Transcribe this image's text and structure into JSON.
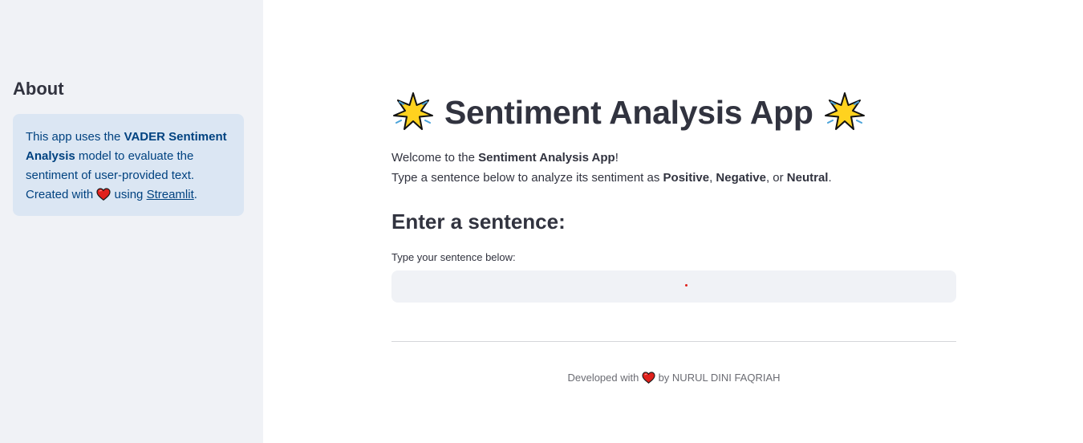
{
  "sidebar": {
    "title": "About",
    "info": {
      "t1": "This app uses the ",
      "b1": "VADER Sentiment Analysis",
      "t2": " model to evaluate the sentiment of user-provided text. Created with ",
      "t3": " using ",
      "link": "Streamlit",
      "t4": "."
    }
  },
  "main": {
    "title": "Sentiment Analysis App",
    "intro": {
      "l1a": "Welcome to the ",
      "l1b": "Sentiment Analysis App",
      "l1c": "!",
      "l2a": "Type a sentence below to analyze its sentiment as ",
      "pos": "Positive",
      "sep1": ", ",
      "neg": "Negative",
      "sep2": ", or ",
      "neu": "Neutral",
      "end": "."
    },
    "subheader": "Enter a sentence:",
    "input": {
      "label": "Type your sentence below:",
      "value": ""
    }
  },
  "footer": {
    "pre": "Developed with ",
    "post": " by NURUL DINI FAQRIAH"
  },
  "colors": {
    "sidebar_bg": "#f0f2f6",
    "info_bg": "#dbe6f3",
    "info_text": "#004280",
    "text": "#31333f",
    "heart": "#e0201b",
    "star": "#ffd21f"
  },
  "icons": {
    "title_left": "sparkle-star-icon",
    "title_right": "sparkle-star-icon",
    "heart": "heart-icon"
  }
}
